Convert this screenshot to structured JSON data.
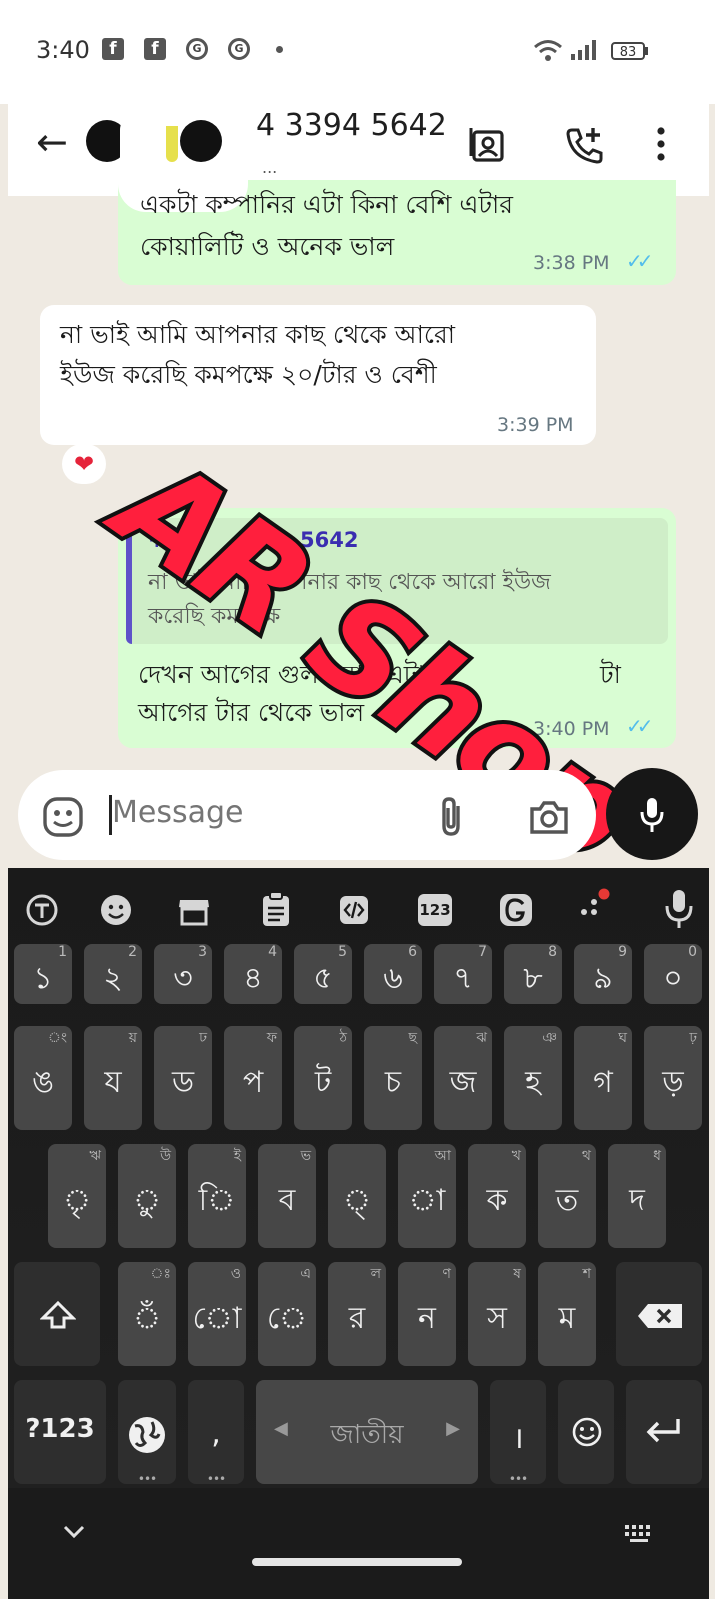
{
  "status_bar": {
    "time": "3:40",
    "battery": "83",
    "icons": [
      "facebook-icon",
      "facebook-icon",
      "gmail-icon",
      "gmail-icon",
      "dot-icon",
      "wifi-icon",
      "signal-icon",
      "battery-icon"
    ]
  },
  "header": {
    "contact_number": "4 3394 5642",
    "contact_subtitle": "...",
    "icons": [
      "back-arrow-icon",
      "contact-card-icon",
      "add-call-icon",
      "more-vert-icon"
    ]
  },
  "messages": [
    {
      "direction": "out",
      "text_line1": "একটা কম্পানির এটা কিনা বেশি এটার",
      "text_line2": "কোয়ালিটি ও অনেক ভাল",
      "time": "3:38 PM",
      "status": "read"
    },
    {
      "direction": "in",
      "text_line1": "না ভাই আমি আপনার কাছ থেকে  আরো",
      "text_line2": "ইউজ করেছি কমপক্ষে ২০/টার ও বেশী",
      "time": "3:39 PM",
      "reaction": "❤"
    },
    {
      "direction": "out",
      "quote": {
        "sender": "+97",
        "sender_tail": "5642",
        "line1": "না ভাই আমি আপনার কাছ থেকে  আরো ইউজ",
        "line2": "করেছি কমপক্ষে"
      },
      "text_line1": "দেখন আগের গুলা আর এটা",
      "text_line2": "আগের টার থেকে ভাল",
      "text_tail": "টা",
      "time": "3:40 PM",
      "status": "read"
    }
  ],
  "watermark": "AR Shop",
  "composer": {
    "placeholder": "Message"
  },
  "keyboard": {
    "toolbar": [
      "text-mode-icon",
      "emoji-icon",
      "shop-icon",
      "clipboard-icon",
      "code-icon",
      "numeric-icon",
      "grammar-icon",
      "more-icon",
      "voice-icon"
    ],
    "toolbar_123": "123",
    "row1": [
      {
        "k": "১",
        "h": "1"
      },
      {
        "k": "২",
        "h": "2"
      },
      {
        "k": "৩",
        "h": "3"
      },
      {
        "k": "৪",
        "h": "4"
      },
      {
        "k": "৫",
        "h": "5"
      },
      {
        "k": "৬",
        "h": "6"
      },
      {
        "k": "৭",
        "h": "7"
      },
      {
        "k": "৮",
        "h": "8"
      },
      {
        "k": "৯",
        "h": "9"
      },
      {
        "k": "০",
        "h": "0"
      }
    ],
    "row2": [
      {
        "k": "ঙ",
        "h": "ং"
      },
      {
        "k": "য",
        "h": "য়"
      },
      {
        "k": "ড",
        "h": "ঢ"
      },
      {
        "k": "প",
        "h": "ফ"
      },
      {
        "k": "ট",
        "h": "ঠ"
      },
      {
        "k": "চ",
        "h": "ছ"
      },
      {
        "k": "জ",
        "h": "ঝ"
      },
      {
        "k": "হ",
        "h": "ঞ"
      },
      {
        "k": "গ",
        "h": "ঘ"
      },
      {
        "k": "ড়",
        "h": "ঢ়"
      }
    ],
    "row3": [
      {
        "k": "ৃ",
        "h": "ঋ"
      },
      {
        "k": "ু",
        "h": "উ"
      },
      {
        "k": "ি",
        "h": "ই"
      },
      {
        "k": "ব",
        "h": "ভ"
      },
      {
        "k": "্",
        "h": ""
      },
      {
        "k": "া",
        "h": "আ"
      },
      {
        "k": "ক",
        "h": "খ"
      },
      {
        "k": "ত",
        "h": "থ"
      },
      {
        "k": "দ",
        "h": "ধ"
      }
    ],
    "row4": [
      {
        "k": "ঁ",
        "h": "ঃ"
      },
      {
        "k": "ো",
        "h": "ও"
      },
      {
        "k": "ে",
        "h": "এ"
      },
      {
        "k": "র",
        "h": "ল"
      },
      {
        "k": "ন",
        "h": "ণ"
      },
      {
        "k": "স",
        "h": "ষ"
      },
      {
        "k": "ম",
        "h": "শ"
      }
    ],
    "sym_label": "?123",
    "comma": ",",
    "space_label": "জাতীয়",
    "danda": "।",
    "enter_icon": "enter-icon"
  }
}
